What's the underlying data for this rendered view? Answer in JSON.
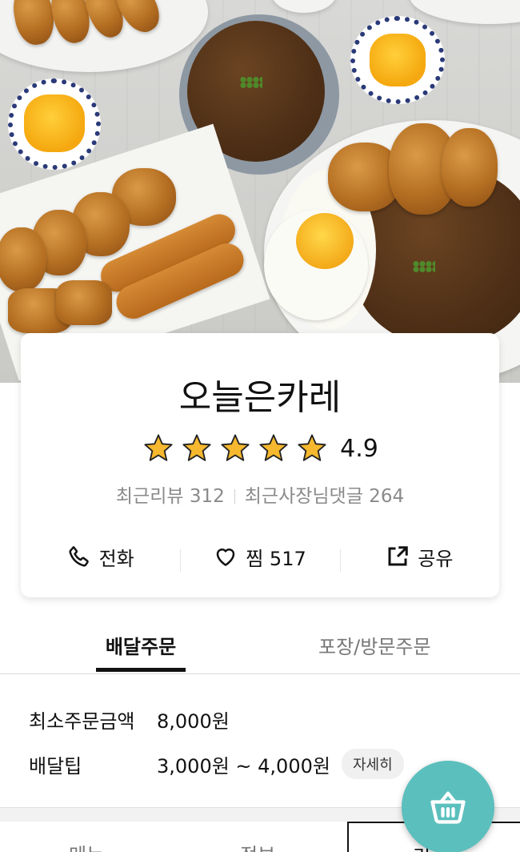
{
  "store": {
    "name": "오늘은카레",
    "rating": "4.9",
    "stars": 5,
    "recent_reviews_label": "최근리뷰 312",
    "owner_replies_label": "최근사장님댓글 264"
  },
  "actions": {
    "call_label": "전화",
    "favorite_label": "찜 517",
    "share_label": "공유"
  },
  "order_tabs": {
    "delivery_label": "배달주문",
    "pickup_label": "포장/방문주문",
    "active": "delivery"
  },
  "delivery_info": {
    "min_order_label": "최소주문금액",
    "min_order_value": "8,000원",
    "delivery_tip_label": "배달팁",
    "delivery_tip_value": "3,000원 ~ 4,000원",
    "detail_label": "자세히"
  },
  "bottom_tabs": {
    "menu_label": "메뉴",
    "info_label": "정보",
    "review_label": "리"
  },
  "colors": {
    "accent": "#5bbfbd",
    "star": "#f5b82e",
    "muted_text": "#8a8a8a"
  },
  "icons": {
    "call": "phone-icon",
    "favorite": "heart-icon",
    "share": "share-icon",
    "cart": "basket-icon",
    "star": "star-icon"
  }
}
